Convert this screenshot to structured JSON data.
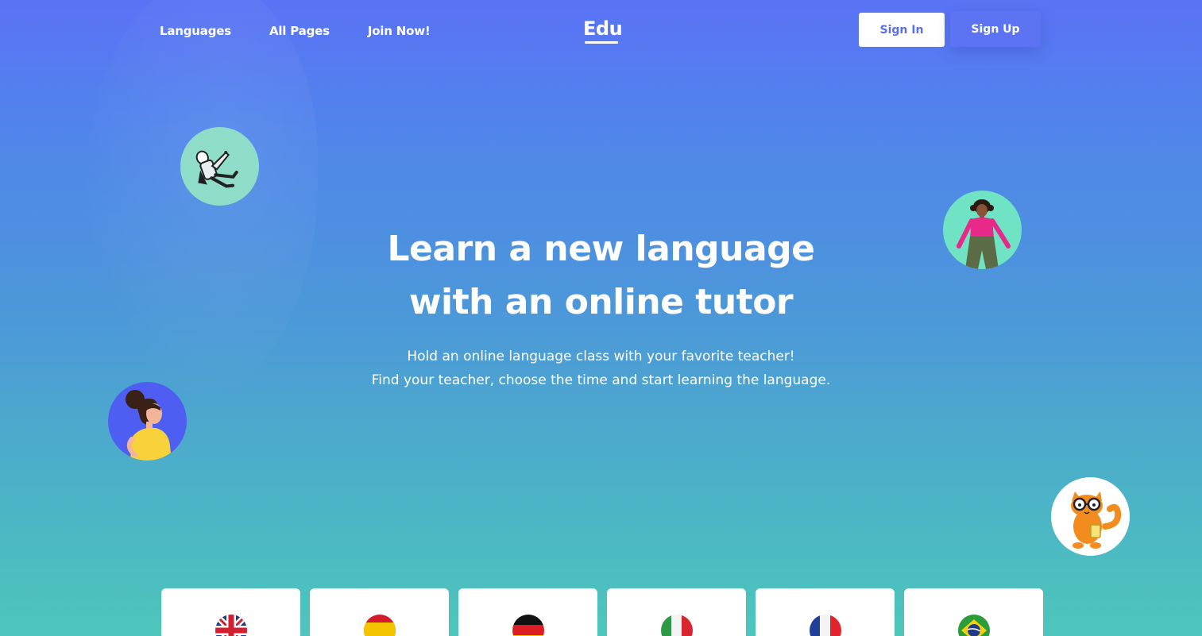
{
  "nav": {
    "links": [
      "Languages",
      "All Pages",
      "Join Now!"
    ],
    "logo": "Edu",
    "sign_in": "Sign In",
    "sign_up": "Sign Up"
  },
  "hero": {
    "title_line1": "Learn a new language",
    "title_line2": "with an online tutor",
    "subtitle_line1": "Hold an online language class with your favorite teacher!",
    "subtitle_line2": "Find your teacher, choose the time and start learning the language."
  },
  "avatars": [
    {
      "name": "astronaut-avatar"
    },
    {
      "name": "woman-pink-avatar"
    },
    {
      "name": "woman-yellow-avatar"
    },
    {
      "name": "cat-avatar"
    }
  ],
  "language_cards": [
    {
      "flag": "uk-flag-icon"
    },
    {
      "flag": "spain-flag-icon"
    },
    {
      "flag": "germany-flag-icon"
    },
    {
      "flag": "italy-flag-icon"
    },
    {
      "flag": "france-flag-icon"
    },
    {
      "flag": "brazil-flag-icon"
    }
  ],
  "colors": {
    "accent": "#5a6ef0",
    "gradient_top": "#5a72f5",
    "gradient_bottom": "#4dc6bb"
  }
}
